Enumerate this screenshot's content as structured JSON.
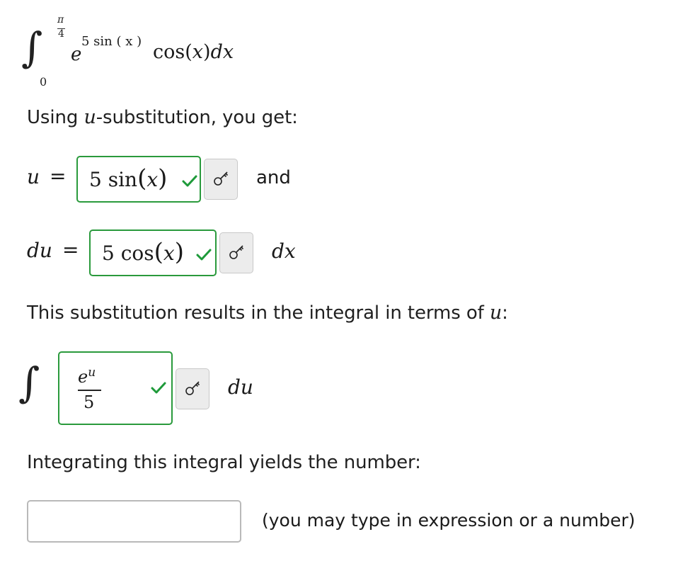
{
  "problem": {
    "integral_sign": "∫",
    "upper_limit_num": "π",
    "upper_limit_den": "4",
    "lower_limit": "0",
    "integrand_base": "e",
    "integrand_exponent": "5 sin ( x )",
    "integrand_rest_cos": "cos(",
    "integrand_rest_x": "x",
    "integrand_rest_close": ")",
    "integrand_rest_dx": "dx"
  },
  "intro_text_before": "Using ",
  "intro_var": "u",
  "intro_text_after": "-substitution, you get:",
  "u_row": {
    "label_var": "u",
    "equals": "=",
    "answer_prefix": "5 sin",
    "answer_open": "(",
    "answer_var": "x",
    "answer_close": ")",
    "status": "correct",
    "connector": "and"
  },
  "du_row": {
    "label_var": "du",
    "equals": "=",
    "answer_prefix": "5 cos",
    "answer_open": "(",
    "answer_var": "x",
    "answer_close": ")",
    "status": "correct",
    "suffix_var": "dx"
  },
  "result_text_before": "This substitution results in the integral in terms of ",
  "result_var": "u",
  "result_text_after": ":",
  "integral_u": {
    "sign": "∫",
    "numerator": "e",
    "numerator_exp": "u",
    "denominator": "5",
    "status": "correct",
    "suffix_var": "du"
  },
  "final_prompt": "Integrating this integral yields the number:",
  "final_input": {
    "value": "",
    "placeholder": ""
  },
  "final_hint": "(you may type in expression or a number)",
  "icons": {
    "check": "check-icon",
    "key": "key-icon"
  },
  "colors": {
    "correct_green": "#2a9a3c",
    "key_button_bg": "#ececec",
    "input_border": "#b9b9b9"
  }
}
